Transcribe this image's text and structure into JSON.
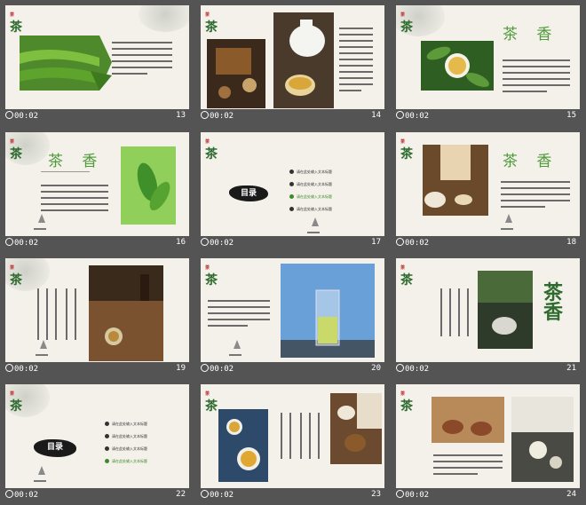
{
  "slides": [
    {
      "time": "00:02",
      "num": "13"
    },
    {
      "time": "00:02",
      "num": "14"
    },
    {
      "time": "00:02",
      "num": "15",
      "title": "茶 香"
    },
    {
      "time": "00:02",
      "num": "16",
      "title": "茶 香"
    },
    {
      "time": "00:02",
      "num": "17",
      "mulu": "目录",
      "menu": [
        "请在此处输入文本标题"
      ]
    },
    {
      "time": "00:02",
      "num": "18",
      "title": "茶 香"
    },
    {
      "time": "00:02",
      "num": "19"
    },
    {
      "time": "00:02",
      "num": "20"
    },
    {
      "time": "00:02",
      "num": "21",
      "brand": "茶香"
    },
    {
      "time": "00:02",
      "num": "22",
      "mulu": "目录",
      "menu": [
        "请在此处输入文本标题"
      ]
    },
    {
      "time": "00:02",
      "num": "23"
    },
    {
      "time": "00:02",
      "num": "24"
    }
  ],
  "logo": "茶"
}
